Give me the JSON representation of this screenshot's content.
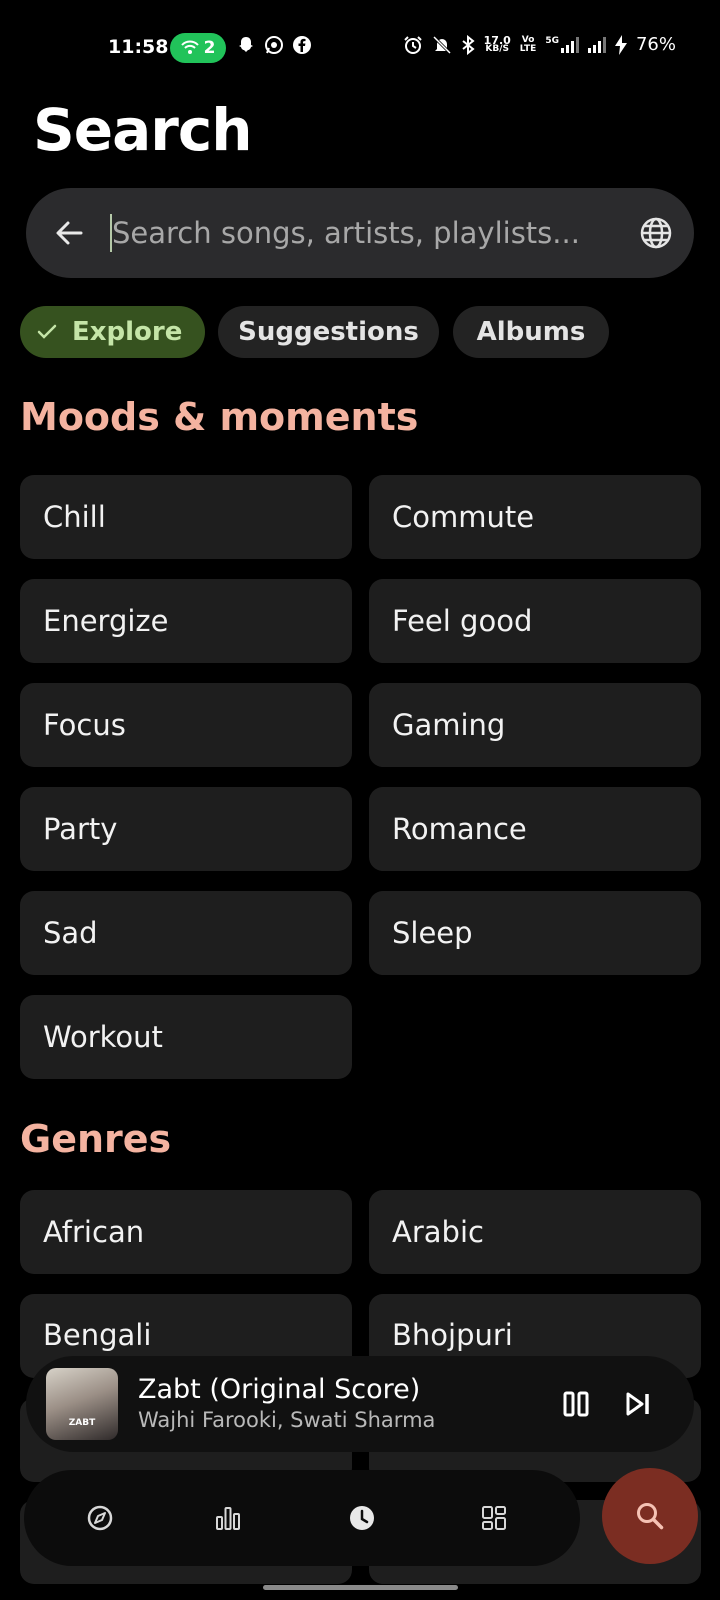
{
  "status_bar": {
    "time": "11:58",
    "hotspot_count": "2",
    "network_speed": "17.0",
    "network_speed_unit": "KB/S",
    "volte_label": "Vo",
    "volte_sublabel": "LTE",
    "network_type": "5G",
    "battery": "76%"
  },
  "page": {
    "title": "Search"
  },
  "search": {
    "placeholder": "Search songs, artists, playlists...",
    "value": ""
  },
  "filters": [
    {
      "label": "Explore",
      "selected": true
    },
    {
      "label": "Suggestions",
      "selected": false
    },
    {
      "label": "Albums",
      "selected": false
    }
  ],
  "moods": {
    "title": "Moods & moments",
    "items": [
      "Chill",
      "Commute",
      "Energize",
      "Feel good",
      "Focus",
      "Gaming",
      "Party",
      "Romance",
      "Sad",
      "Sleep",
      "Workout"
    ]
  },
  "genres": {
    "title": "Genres",
    "items": [
      "African",
      "Arabic",
      "Bengali",
      "Bhojpuri"
    ]
  },
  "now_playing": {
    "title": "Zabt (Original Score)",
    "artist": "Wajhi Farooki, Swati Sharma",
    "cover_text": "ZABT"
  },
  "nav": {
    "items": [
      "explore-icon",
      "charts-icon",
      "history-icon",
      "library-icon"
    ],
    "fab": "search-icon"
  },
  "colors": {
    "accent_section": "#f4b3a0",
    "chip_selected_bg": "#36521f",
    "fab_bg": "#7b2d22"
  }
}
